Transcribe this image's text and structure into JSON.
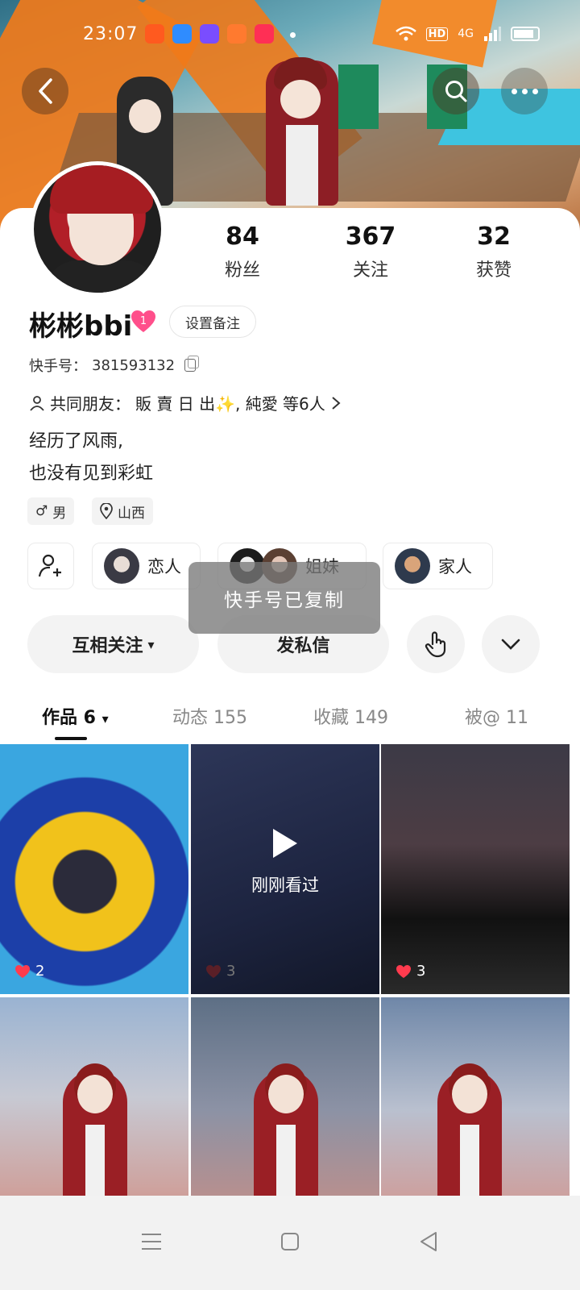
{
  "status_bar": {
    "time": "23:07",
    "network": "4G",
    "hd_label": "HD"
  },
  "profile": {
    "name": "彬彬bbi",
    "level": "1",
    "remark_button": "设置备注",
    "kuaishou_id_label": "快手号：",
    "kuaishou_id": "381593132",
    "mutual_friends_label": "共同朋友：",
    "mutual_friends_value": "販 賣 日 出✨, 純愛 等6人",
    "bio_line1": "经历了风雨,",
    "bio_line2": "也没有见到彩虹",
    "gender_icon": "♂",
    "gender": "男",
    "region": "山西"
  },
  "stats": {
    "fans": {
      "value": "84",
      "label": "粉丝"
    },
    "following": {
      "value": "367",
      "label": "关注"
    },
    "likes": {
      "value": "32",
      "label": "获赞"
    }
  },
  "relations": [
    {
      "label": "恋人"
    },
    {
      "label": "姐妹"
    },
    {
      "label": "家人"
    }
  ],
  "toast": "快手号已复制",
  "actions": {
    "mutual_follow": "互相关注",
    "mutual_caret": "▾",
    "message": "发私信"
  },
  "tabs": {
    "works": "作品 6",
    "works_caret": "▾",
    "moments": "动态 155",
    "favorites": "收藏 149",
    "mentioned": "被@ 11"
  },
  "grid": {
    "tiles": [
      {
        "likes": "2"
      },
      {
        "likes": "3",
        "overlay": "刚刚看过"
      },
      {
        "likes": "3"
      }
    ]
  },
  "colors": {
    "accent_orange": "#f07a1a",
    "heart_red": "#ff3b4e",
    "level_pink": "#ff4f8b"
  },
  "icons": {
    "back": "back-icon",
    "search": "search-icon",
    "more": "more-icon",
    "copy": "copy-icon",
    "person": "person-icon",
    "chevron": "chevron-right-icon",
    "location": "location-pin-icon",
    "add_friend": "add-friend-icon",
    "poke": "poke-hand-icon",
    "expand": "chevron-down-icon"
  }
}
